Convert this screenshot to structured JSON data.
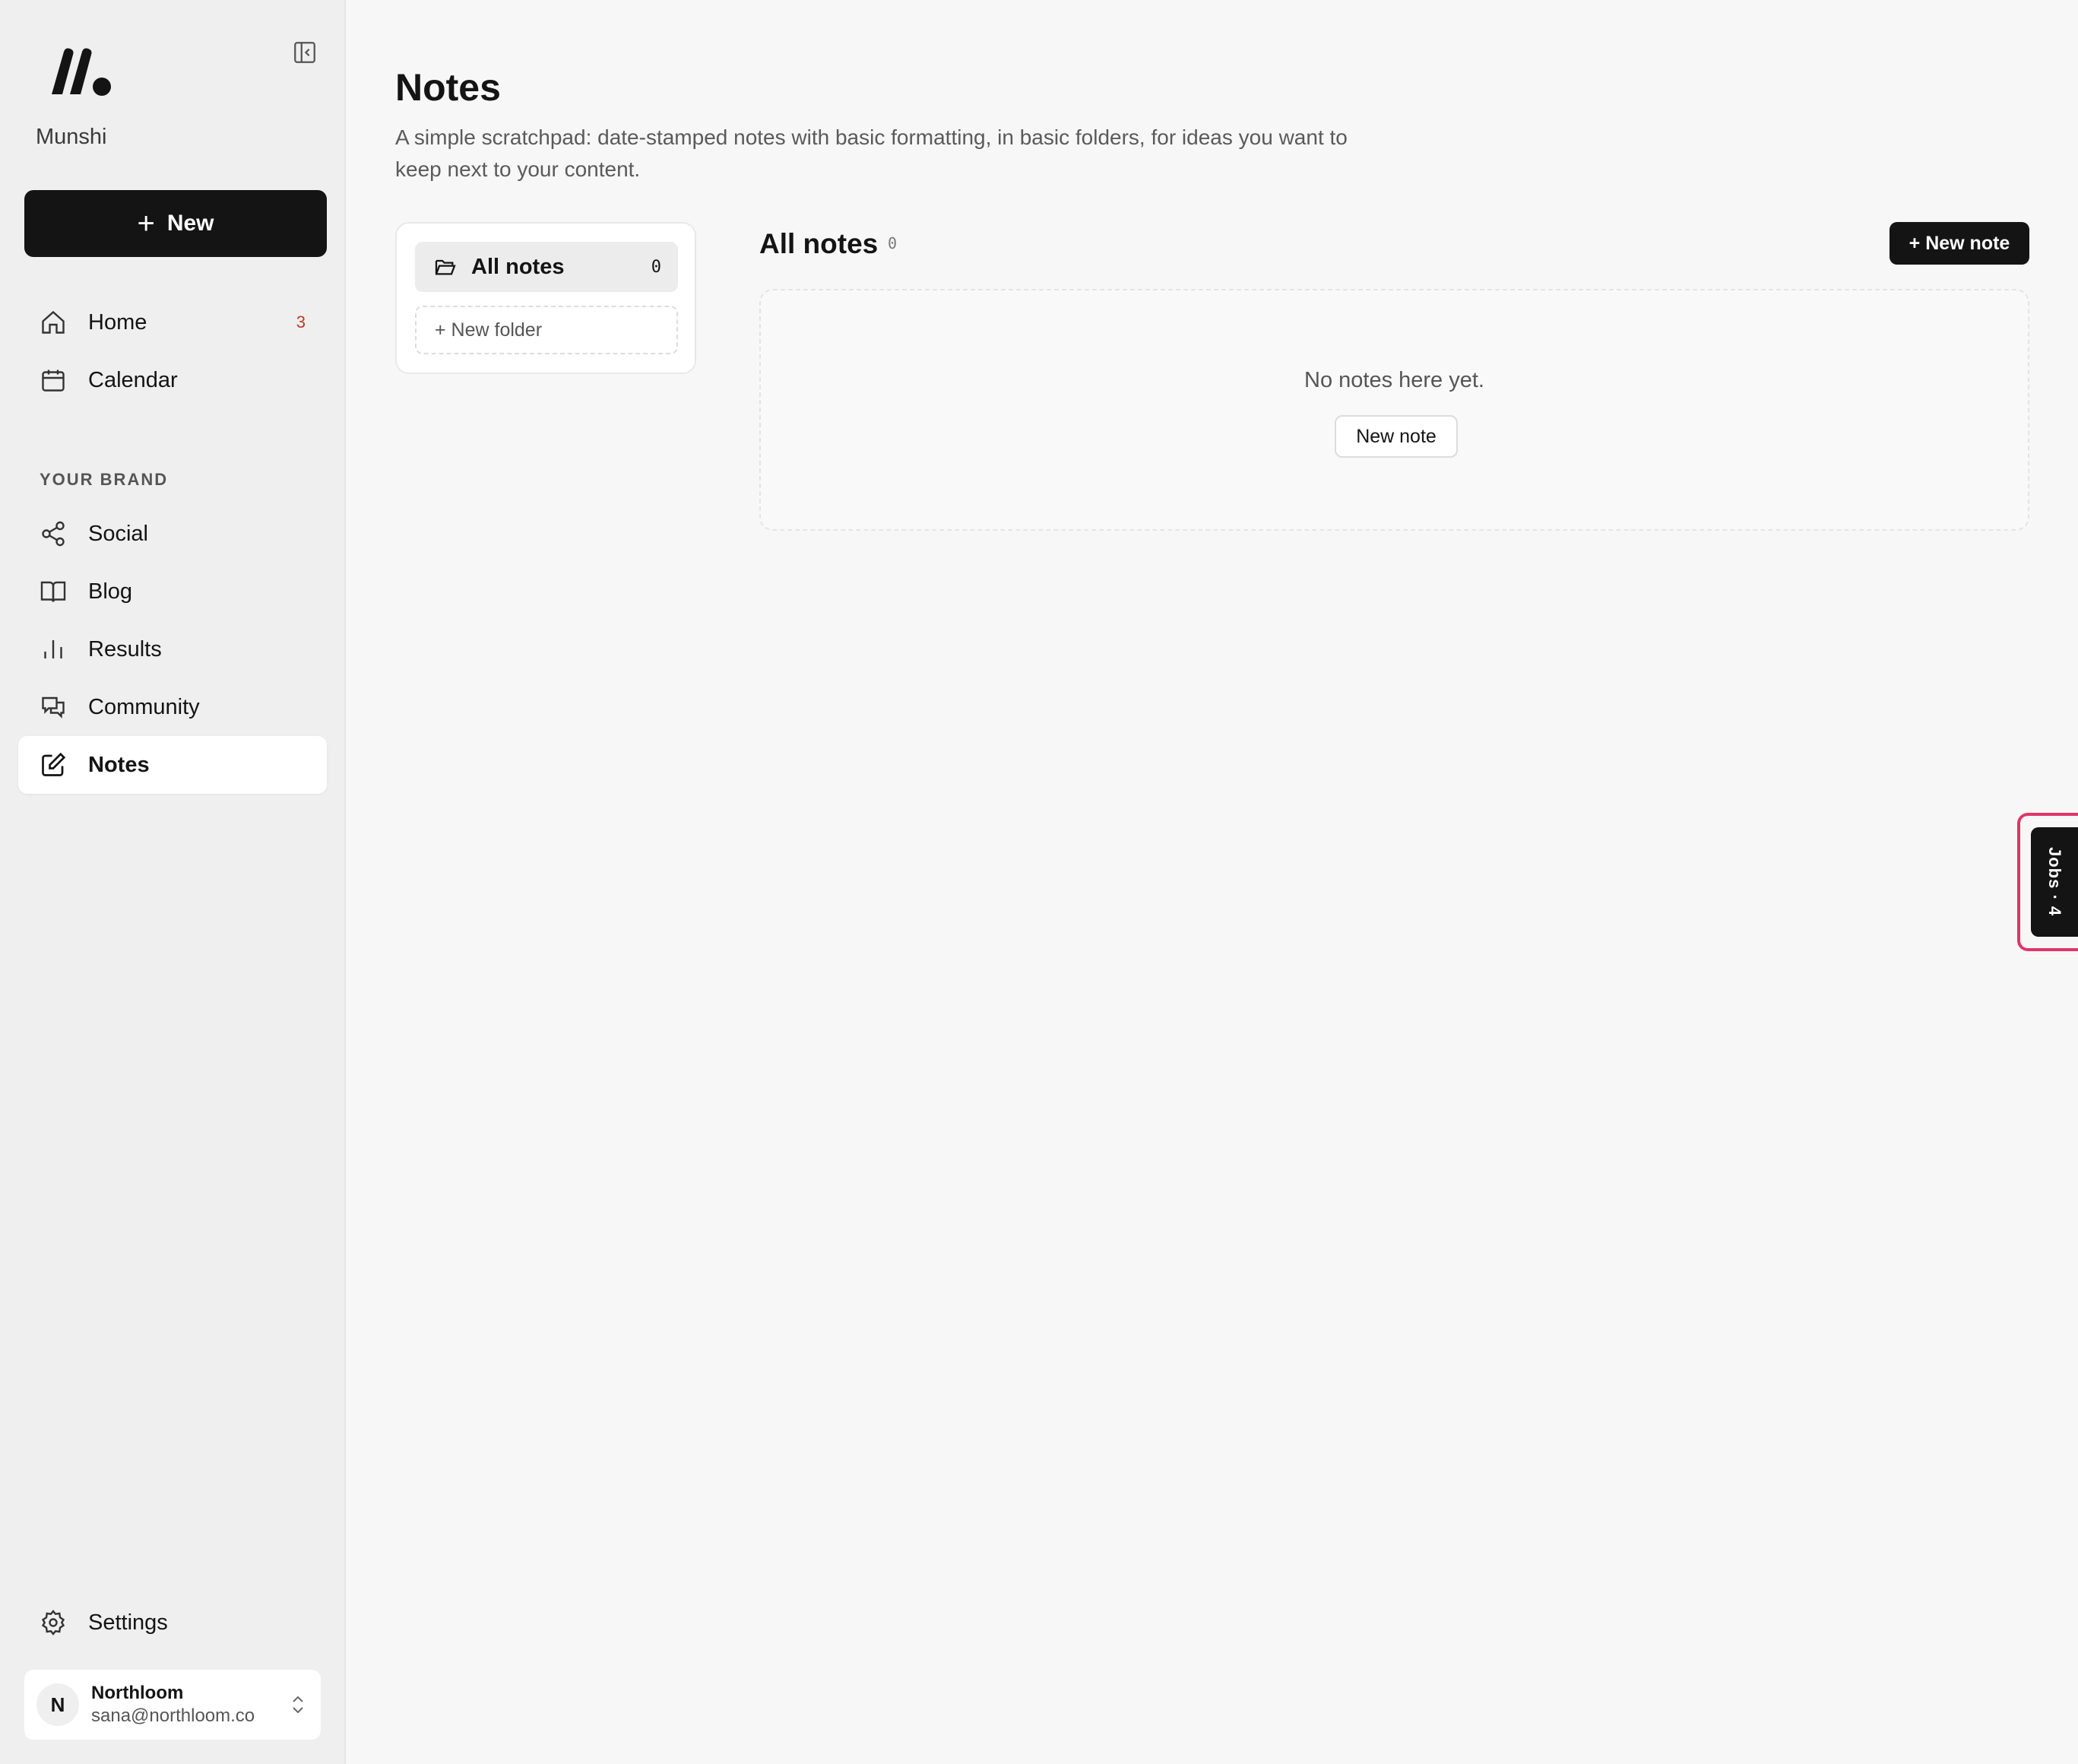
{
  "app": {
    "name": "Munshi",
    "new_label": "New"
  },
  "nav": {
    "primary": [
      {
        "label": "Home",
        "icon": "home-icon",
        "badge": "3"
      },
      {
        "label": "Calendar",
        "icon": "calendar-icon"
      }
    ],
    "section_label": "YOUR BRAND",
    "brand": [
      {
        "label": "Social",
        "icon": "share-icon"
      },
      {
        "label": "Blog",
        "icon": "book-icon"
      },
      {
        "label": "Results",
        "icon": "bar-chart-icon"
      },
      {
        "label": "Community",
        "icon": "chat-icon"
      },
      {
        "label": "Notes",
        "icon": "edit-icon",
        "active": true
      }
    ],
    "settings_label": "Settings"
  },
  "account": {
    "initial": "N",
    "name": "Northloom",
    "email": "sana@northloom.co"
  },
  "page": {
    "title": "Notes",
    "description": "A simple scratchpad: date-stamped notes with basic formatting, in basic folders, for ideas you want to keep next to your content."
  },
  "folders": {
    "all_label": "All notes",
    "all_count": "0",
    "new_folder_label": "+ New folder"
  },
  "list": {
    "title": "All notes",
    "count": "0",
    "new_note_label": "+ New note",
    "empty_text": "No notes here yet.",
    "empty_button_label": "New note"
  },
  "jobs_tab": {
    "label": "Jobs · 4"
  },
  "colors": {
    "accent": "#141414",
    "focus_ring": "#e0356a",
    "badge": "#c0392b"
  }
}
